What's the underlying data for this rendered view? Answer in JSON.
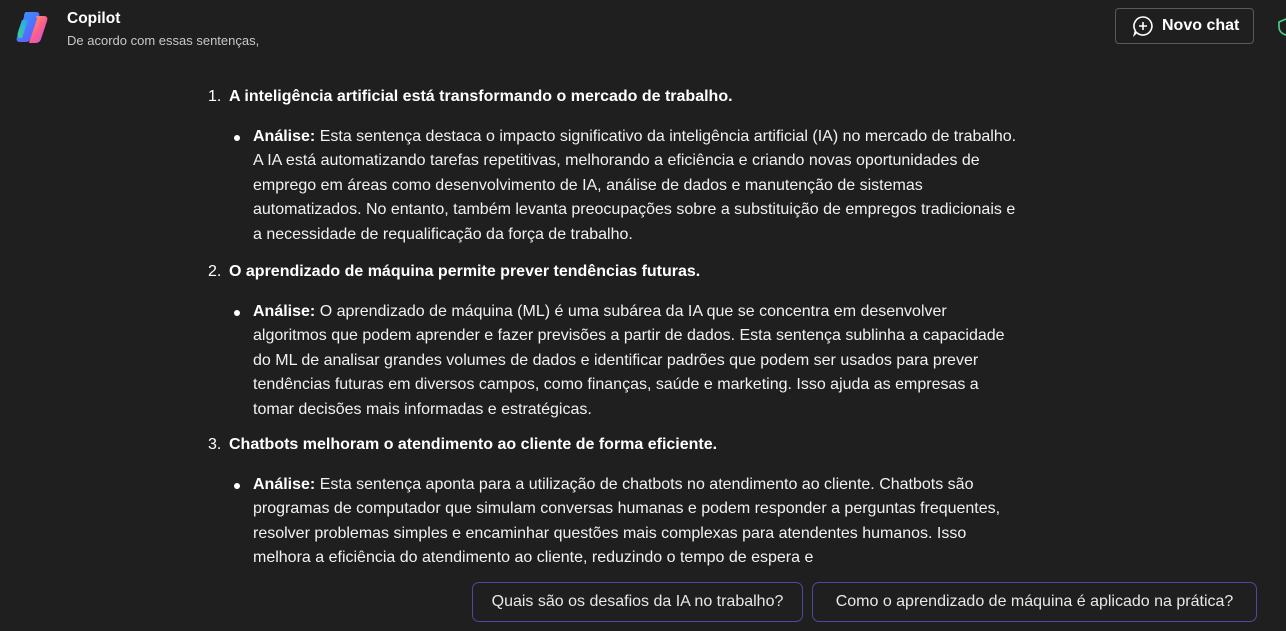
{
  "header": {
    "title": "Copilot",
    "subtitle": "De acordo com essas sentenças,",
    "new_chat_label": "Novo chat"
  },
  "items": [
    {
      "number": "1.",
      "heading": "A inteligência artificial está transformando o mercado de trabalho.",
      "analysis_label": "Análise:",
      "analysis_text": " Esta sentença destaca o impacto significativo da inteligência artificial (IA) no mercado de trabalho. A IA está automatizando tarefas repetitivas, melhorando a eficiência e criando novas oportunidades de emprego em áreas como desenvolvimento de IA, análise de dados e manutenção de sistemas automatizados. No entanto, também levanta preocupações sobre a substituição de empregos tradicionais e a necessidade de requalificação da força de trabalho."
    },
    {
      "number": "2.",
      "heading": "O aprendizado de máquina permite prever tendências futuras.",
      "analysis_label": "Análise:",
      "analysis_text": " O aprendizado de máquina (ML) é uma subárea da IA que se concentra em desenvolver algoritmos que podem aprender e fazer previsões a partir de dados. Esta sentença sublinha a capacidade do ML de analisar grandes volumes de dados e identificar padrões que podem ser usados para prever tendências futuras em diversos campos, como finanças, saúde e marketing. Isso ajuda as empresas a tomar decisões mais informadas e estratégicas."
    },
    {
      "number": "3.",
      "heading": "Chatbots melhoram o atendimento ao cliente de forma eficiente.",
      "analysis_label": "Análise:",
      "analysis_text": " Esta sentença aponta para a utilização de chatbots no atendimento ao cliente. Chatbots são programas de computador que simulam conversas humanas e podem responder a perguntas frequentes, resolver problemas simples e encaminhar questões mais complexas para atendentes humanos. Isso melhora a eficiência do atendimento ao cliente, reduzindo o tempo de espera e"
    }
  ],
  "suggestions": [
    "Quais são os desafios da IA no trabalho?",
    "Como o aprendizado de máquina é aplicado na prática?"
  ],
  "icons": {
    "logo": "copilot-logo",
    "new_chat": "chat-plus-icon",
    "edge": "shield-icon"
  },
  "colors": {
    "background": "#1f1f1f",
    "chip_border": "#4d4a9e"
  }
}
